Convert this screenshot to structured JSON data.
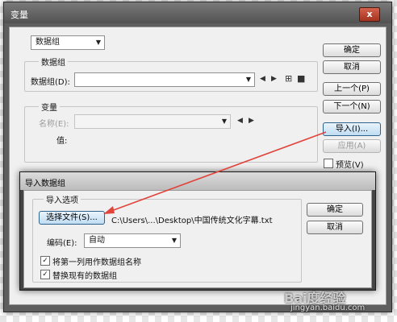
{
  "main_dialog": {
    "title": "变量",
    "close_label": "x",
    "top_select": "数据组",
    "dataset_group": {
      "legend": "数据组",
      "field_label": "数据组(D):",
      "field_value": ""
    },
    "variable_group": {
      "legend": "变量",
      "name_label": "名称(E):",
      "name_value": "",
      "value_label": "值:"
    },
    "buttons": {
      "ok": "确定",
      "cancel": "取消",
      "prev": "上一个(P)",
      "next": "下一个(N)",
      "import": "导入(I)...",
      "apply": "应用(A)"
    },
    "preview_label": "预览(V)",
    "preview_checked": false
  },
  "import_dialog": {
    "title": "导入数据组",
    "options_legend": "导入选项",
    "choose_file_label": "选择文件(S)...",
    "file_path": "C:\\Users\\...\\Desktop\\中国传统文化字幕.txt",
    "encoding_label": "编码(E):",
    "encoding_value": "自动",
    "use_first_col_label": "将第一列用作数据组名称",
    "use_first_col_checked": true,
    "replace_existing_label": "替换现有的数据组",
    "replace_existing_checked": true,
    "ok": "确定",
    "cancel": "取消"
  },
  "watermark": {
    "brand": "Bai度经验",
    "url": "jingyan.baidu.com"
  },
  "colors": {
    "annotation_arrow": "#e0443a"
  }
}
